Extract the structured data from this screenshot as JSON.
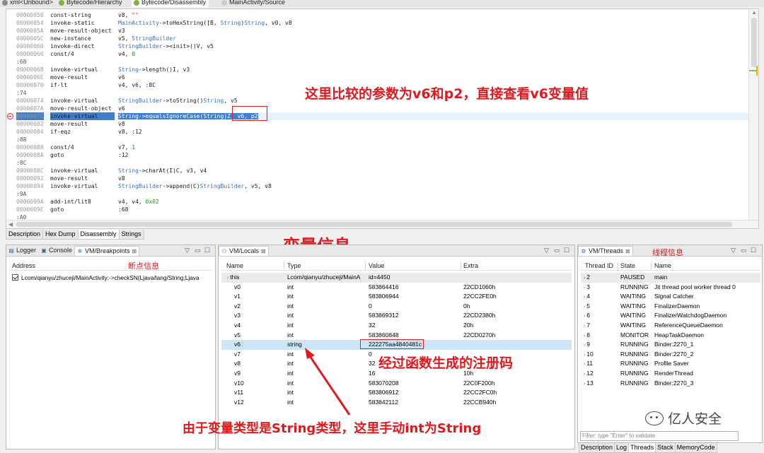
{
  "top_tabs": [
    {
      "label": "xml<Unbound>"
    },
    {
      "label": "Bytecode/Hierarchy"
    },
    {
      "label": "Bytecode/Disassembly"
    },
    {
      "label": "MainActivity/Source"
    }
  ],
  "code": [
    {
      "addr": "00000050",
      "op": "const-string",
      "args": [
        {
          "t": "v8, "
        },
        {
          "t": "\"\"",
          "c": "red"
        }
      ]
    },
    {
      "addr": "00000054",
      "op": "invoke-static",
      "args": [
        {
          "t": "MainActivity",
          "c": "blue"
        },
        {
          "t": "->toHexString([B, "
        },
        {
          "t": "String",
          "c": "blue"
        },
        {
          "t": ")"
        },
        {
          "t": "String",
          "c": "blue"
        },
        {
          "t": ", v0, v8"
        }
      ]
    },
    {
      "addr": "0000005A",
      "op": "move-result-object",
      "args": [
        {
          "t": "v3"
        }
      ]
    },
    {
      "addr": "0000005C",
      "op": "new-instance",
      "args": [
        {
          "t": "v5, "
        },
        {
          "t": "StringBuilder",
          "c": "blue"
        }
      ]
    },
    {
      "addr": "00000060",
      "op": "invoke-direct",
      "args": [
        {
          "t": "StringBuilder",
          "c": "blue"
        },
        {
          "t": "-><init>()V, v5"
        }
      ]
    },
    {
      "addr": "00000066",
      "op": "const/4",
      "args": [
        {
          "t": "v4, "
        },
        {
          "t": "0",
          "c": "green"
        }
      ]
    },
    {
      "label": ":68"
    },
    {
      "addr": "00000068",
      "op": "invoke-virtual",
      "args": [
        {
          "t": "String",
          "c": "blue"
        },
        {
          "t": "->length()I, v3"
        }
      ]
    },
    {
      "addr": "0000006E",
      "op": "move-result",
      "args": [
        {
          "t": "v6"
        }
      ]
    },
    {
      "addr": "00000070",
      "op": "if-lt",
      "args": [
        {
          "t": "v4, v6, :8C"
        }
      ]
    },
    {
      "label": ":74"
    },
    {
      "addr": "00000074",
      "op": "invoke-virtual",
      "args": [
        {
          "t": "StringBuilder",
          "c": "blue"
        },
        {
          "t": "->toString()"
        },
        {
          "t": "String",
          "c": "blue"
        },
        {
          "t": ", v5"
        }
      ]
    },
    {
      "addr": "0000007A",
      "op": "move-result-object",
      "args": [
        {
          "t": "v6"
        }
      ]
    },
    {
      "addr": "0000007C",
      "op": "invoke-virtual",
      "highlight": true,
      "breakpoint": true,
      "args": [
        {
          "t": "String",
          "c": "sel"
        },
        {
          "t": "->equalsIgnoreCase(String)Z, ",
          "c": "sel"
        },
        {
          "t": "v6, p2",
          "c": "sel"
        }
      ]
    },
    {
      "addr": "00000082",
      "op": "move-result",
      "args": [
        {
          "t": "v8"
        }
      ]
    },
    {
      "addr": "00000084",
      "op": "if-eqz",
      "args": [
        {
          "t": "v8, :12"
        }
      ]
    },
    {
      "label": ":88"
    },
    {
      "addr": "00000088",
      "op": "const/4",
      "args": [
        {
          "t": "v7, "
        },
        {
          "t": "1",
          "c": "green"
        }
      ]
    },
    {
      "addr": "0000008A",
      "op": "goto",
      "args": [
        {
          "t": ":12"
        }
      ]
    },
    {
      "label": ":8C"
    },
    {
      "addr": "0000008C",
      "op": "invoke-virtual",
      "args": [
        {
          "t": "String",
          "c": "blue"
        },
        {
          "t": "->charAt(I)C, v3, v4"
        }
      ]
    },
    {
      "addr": "00000092",
      "op": "move-result",
      "args": [
        {
          "t": "v8"
        }
      ]
    },
    {
      "addr": "00000094",
      "op": "invoke-virtual",
      "args": [
        {
          "t": "StringBuilder",
          "c": "blue"
        },
        {
          "t": "->append(C)"
        },
        {
          "t": "StringBuilder",
          "c": "blue"
        },
        {
          "t": ", v5, v8"
        }
      ]
    },
    {
      "label": ":9A"
    },
    {
      "addr": "0000009A",
      "op": "add-int/lit8",
      "args": [
        {
          "t": "v4, v4, "
        },
        {
          "t": "0x02",
          "c": "green"
        }
      ]
    },
    {
      "addr": "0000009E",
      "op": "goto",
      "args": [
        {
          "t": ":68"
        }
      ]
    },
    {
      "label": ":A0"
    }
  ],
  "annotations": {
    "compare_note": "这里比较的参数为v6和p2，直接查看v6变量值",
    "locals_title": "变量信息",
    "breakpoint_note": "断点信息",
    "thread_note": "线程信息",
    "generated_note": "经过函数生成的注册码",
    "type_note": "由于变量类型是String类型，这里手动int为String"
  },
  "editor_tabs": [
    "Description",
    "Hex Dump",
    "Disassembly",
    "Strings"
  ],
  "breakpoints_panel": {
    "tabs": [
      {
        "label": "Logger"
      },
      {
        "label": "Console"
      },
      {
        "label": "VM/Breakpoints"
      }
    ],
    "header": "Address",
    "items": [
      "Lcom/qianyu/zhuceji/MainActivity;->checkSN(Ljava/lang/String;Ljava"
    ]
  },
  "locals_panel": {
    "tab": "VM/Locals",
    "columns": [
      "Name",
      "Type",
      "Value",
      "Extra"
    ],
    "rows": [
      {
        "name": "this",
        "type": "Lcom/qianyu/zhuceji/MainA",
        "value": "id=4450",
        "extra": "",
        "expander": true
      },
      {
        "name": "v0",
        "type": "int",
        "value": "583864416",
        "extra": "22CD1060h"
      },
      {
        "name": "v1",
        "type": "int",
        "value": "583806944",
        "extra": "22CC2FE0h"
      },
      {
        "name": "v2",
        "type": "int",
        "value": "0",
        "extra": "0h"
      },
      {
        "name": "v3",
        "type": "int",
        "value": "583869312",
        "extra": "22CD2380h"
      },
      {
        "name": "v4",
        "type": "int",
        "value": "32",
        "extra": "20h"
      },
      {
        "name": "v5",
        "type": "int",
        "value": "583860848",
        "extra": "22CD0270h"
      },
      {
        "name": "v6",
        "type": "string",
        "value": "222275aa4840481c",
        "extra": "",
        "selected": true
      },
      {
        "name": "v7",
        "type": "int",
        "value": "0",
        "extra": ""
      },
      {
        "name": "v8",
        "type": "int",
        "value": "32",
        "extra": ""
      },
      {
        "name": "v9",
        "type": "int",
        "value": "16",
        "extra": "10h"
      },
      {
        "name": "v10",
        "type": "int",
        "value": "583070208",
        "extra": "22C0F200h"
      },
      {
        "name": "v11",
        "type": "int",
        "value": "583806912",
        "extra": "22CC2FC0h"
      },
      {
        "name": "v12",
        "type": "int",
        "value": "583842112",
        "extra": "22CCB940h"
      }
    ]
  },
  "threads_panel": {
    "tab": "VM/Threads",
    "columns": [
      "Thread ID",
      "State",
      "Name"
    ],
    "rows": [
      {
        "id": "2",
        "state": "PAUSED",
        "name": "main"
      },
      {
        "id": "3",
        "state": "RUNNING",
        "name": "Jit thread pool worker thread 0"
      },
      {
        "id": "4",
        "state": "WAITING",
        "name": "Signal Catcher"
      },
      {
        "id": "5",
        "state": "WAITING",
        "name": "FinalizerDaemon"
      },
      {
        "id": "6",
        "state": "WAITING",
        "name": "FinalizerWatchdogDaemon"
      },
      {
        "id": "7",
        "state": "WAITING",
        "name": "ReferenceQueueDaemon"
      },
      {
        "id": "8",
        "state": "MONITOR",
        "name": "HeapTaskDaemon"
      },
      {
        "id": "9",
        "state": "RUNNING",
        "name": "Binder:2270_1"
      },
      {
        "id": "10",
        "state": "RUNNING",
        "name": "Binder:2270_2"
      },
      {
        "id": "11",
        "state": "RUNNING",
        "name": "Profile Saver"
      },
      {
        "id": "12",
        "state": "RUNNING",
        "name": "RenderThread"
      },
      {
        "id": "13",
        "state": "RUNNING",
        "name": "Binder:2270_3"
      }
    ],
    "filter_placeholder": "Filter: type \"Enter\" to validate",
    "bottom_tabs": [
      "Description",
      "Log",
      "Threads",
      "Stack",
      "MemoryCode"
    ]
  },
  "watermark": "亿人安全",
  "icons": {
    "view_menu": "▽",
    "minimize": "▭",
    "maximize": "☐",
    "close": "⊠",
    "expand": "›"
  },
  "colors": {
    "annotation_red": "#e0191f",
    "selection_blue": "#3f7fcf",
    "row_selected": "#cde6f7"
  }
}
